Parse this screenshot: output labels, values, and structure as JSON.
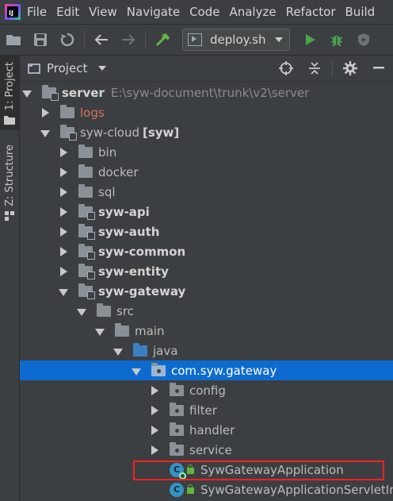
{
  "menubar": {
    "items": [
      "File",
      "Edit",
      "View",
      "Navigate",
      "Code",
      "Analyze",
      "Refactor",
      "Build"
    ]
  },
  "toolbar": {
    "run_config": "deploy.sh",
    "icons": [
      "open-folder-icon",
      "save-icon",
      "sync-icon",
      "back-icon",
      "forward-icon",
      "build-hammer-icon",
      "run-icon",
      "debug-icon",
      "coverage-icon"
    ]
  },
  "left_stripe": {
    "project_tab": "1: Project",
    "structure_tab": "Z: Structure"
  },
  "panel": {
    "title": "Project"
  },
  "tree": {
    "server_name": "server",
    "server_path": "E:\\syw-document\\trunk\\v2\\server",
    "logs": "logs",
    "syw_cloud": "syw-cloud",
    "syw_cloud_tag": "[syw]",
    "bin": "bin",
    "docker": "docker",
    "sql": "sql",
    "syw_api": "syw-api",
    "syw_auth": "syw-auth",
    "syw_common": "syw-common",
    "syw_entity": "syw-entity",
    "syw_gateway": "syw-gateway",
    "src": "src",
    "main": "main",
    "java": "java",
    "package": "com.syw.gateway",
    "config": "config",
    "filter": "filter",
    "handler": "handler",
    "service": "service",
    "class1": "SywGatewayApplication",
    "class2": "SywGatewayApplicationServletInitia"
  },
  "colors": {
    "selection": "#0d6bd0",
    "highlight_border": "#ff2020",
    "logs_text": "#d2745c"
  }
}
